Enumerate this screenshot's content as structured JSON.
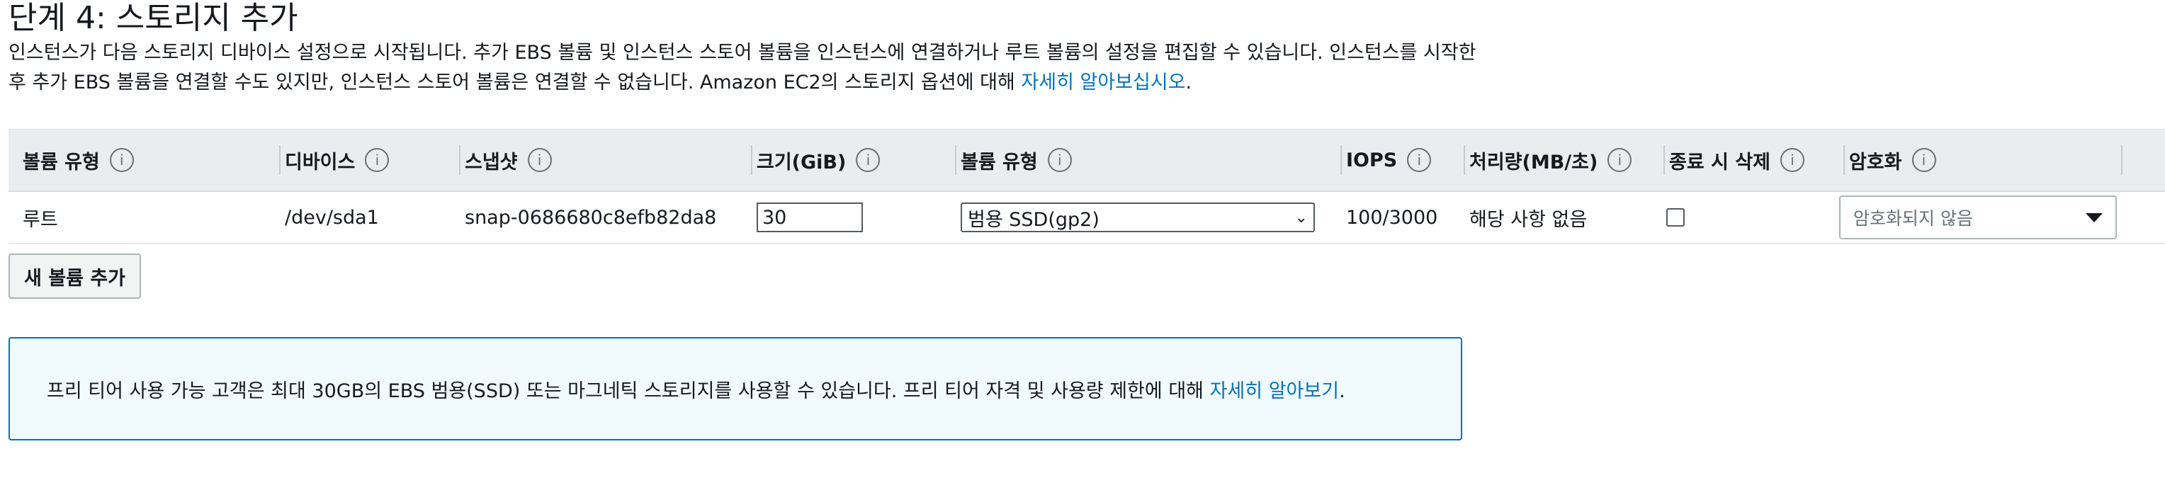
{
  "page": {
    "title": "단계 4: 스토리지 추가",
    "description_line1": "인스턴스가 다음 스토리지 디바이스 설정으로 시작됩니다. 추가 EBS 볼륨 및 인스턴스 스토어 볼륨을 인스턴스에 연결하거나 루트 볼륨의 설정을 편집할 수 있습니다. 인스턴스를 시작한",
    "description_line2": "후 추가 EBS 볼륨을 연결할 수도 있지만, 인스턴스 스토어 볼륨은 연결할 수 없습니다. Amazon EC2의 스토리지 옵션에 대해 ",
    "description_link": "자세히 알아보십시오",
    "description_end": "."
  },
  "table": {
    "columns": [
      {
        "label": "볼륨 유형"
      },
      {
        "label": "디바이스"
      },
      {
        "label": "스냅샷"
      },
      {
        "label": "크기(GiB)"
      },
      {
        "label": "볼륨 유형"
      },
      {
        "label": "IOPS"
      },
      {
        "label": "처리량(MB/초)"
      },
      {
        "label": "종료 시 삭제"
      },
      {
        "label": "암호화"
      }
    ],
    "info_icon_glyph": "i",
    "rows": [
      {
        "volume_type": "루트",
        "device": "/dev/sda1",
        "snapshot": "snap-0686680c8efb82da8",
        "size": "30",
        "ebs_volume_type": "범용 SSD(gp2)",
        "iops": "100/3000",
        "throughput": "해당 사항 없음",
        "delete_on_termination": false,
        "encryption": "암호화되지 않음"
      }
    ]
  },
  "buttons": {
    "add_volume": "새 볼륨 추가"
  },
  "info_box": {
    "text": "프리 티어 사용 가능 고객은 최대 30GB의 EBS 범용(SSD) 또는 마그네틱 스토리지를 사용할 수 있습니다. 프리 티어 자격 및 사용량 제한에 대해 ",
    "link": "자세히 알아보기",
    "end": "."
  },
  "icons": {
    "info": "info-icon",
    "dropdown": "chevron-down-icon",
    "caret": "caret-down-icon"
  },
  "colors": {
    "link": "#0073bb",
    "header_bg": "#eaeded",
    "info_border": "#0073bb",
    "info_bg": "#f1faff"
  }
}
